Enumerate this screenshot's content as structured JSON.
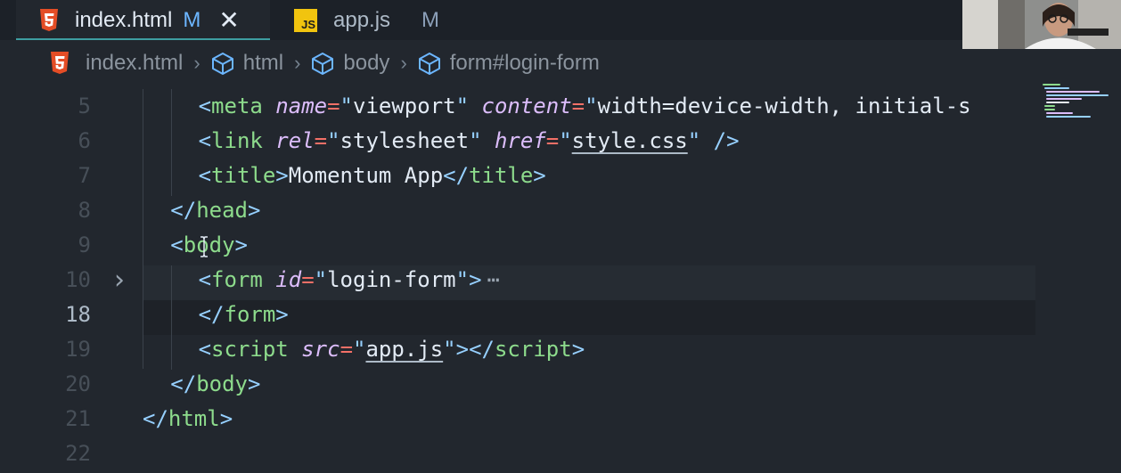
{
  "tabs": [
    {
      "label": "index.html",
      "status": "M",
      "icon": "html5-icon",
      "active": true
    },
    {
      "label": "app.js",
      "status": "M",
      "icon": "js-icon",
      "icon_text": "JS",
      "active": false
    }
  ],
  "breadcrumb": [
    {
      "label": "index.html",
      "icon": "html5-icon"
    },
    {
      "label": "html",
      "icon": "cube-icon"
    },
    {
      "label": "body",
      "icon": "cube-icon"
    },
    {
      "label": "form#login-form",
      "icon": "cube-icon"
    }
  ],
  "editor": {
    "lines": [
      {
        "num": "5",
        "tokens": [
          {
            "t": "punct",
            "v": "<"
          },
          {
            "t": "tag",
            "v": "meta"
          },
          {
            "t": "text",
            "v": " "
          },
          {
            "t": "attr",
            "v": "name"
          },
          {
            "t": "eq",
            "v": "="
          },
          {
            "t": "str",
            "v": "\""
          },
          {
            "t": "str-text",
            "v": "viewport"
          },
          {
            "t": "str",
            "v": "\""
          },
          {
            "t": "text",
            "v": " "
          },
          {
            "t": "attr",
            "v": "content"
          },
          {
            "t": "eq",
            "v": "="
          },
          {
            "t": "str",
            "v": "\""
          },
          {
            "t": "str-text",
            "v": "width=device-width, initial-s"
          }
        ]
      },
      {
        "num": "6",
        "tokens": [
          {
            "t": "punct",
            "v": "<"
          },
          {
            "t": "tag",
            "v": "link"
          },
          {
            "t": "text",
            "v": " "
          },
          {
            "t": "attr",
            "v": "rel"
          },
          {
            "t": "eq",
            "v": "="
          },
          {
            "t": "str",
            "v": "\""
          },
          {
            "t": "str-text",
            "v": "stylesheet"
          },
          {
            "t": "str",
            "v": "\""
          },
          {
            "t": "text",
            "v": " "
          },
          {
            "t": "attr",
            "v": "href"
          },
          {
            "t": "eq",
            "v": "="
          },
          {
            "t": "str",
            "v": "\""
          },
          {
            "t": "link",
            "v": "style.css"
          },
          {
            "t": "str",
            "v": "\""
          },
          {
            "t": "text",
            "v": " "
          },
          {
            "t": "punct",
            "v": "/>"
          }
        ]
      },
      {
        "num": "7",
        "tokens": [
          {
            "t": "punct",
            "v": "<"
          },
          {
            "t": "tag",
            "v": "title"
          },
          {
            "t": "punct",
            "v": ">"
          },
          {
            "t": "text",
            "v": "Momentum App"
          },
          {
            "t": "punct",
            "v": "</"
          },
          {
            "t": "tag",
            "v": "title"
          },
          {
            "t": "punct",
            "v": ">"
          }
        ]
      },
      {
        "num": "8",
        "tokens": [
          {
            "t": "punct",
            "v": "</"
          },
          {
            "t": "tag",
            "v": "head"
          },
          {
            "t": "punct",
            "v": ">"
          }
        ]
      },
      {
        "num": "9",
        "tokens": [
          {
            "t": "punct",
            "v": "<"
          },
          {
            "t": "tag",
            "v": "body"
          },
          {
            "t": "punct",
            "v": ">"
          }
        ]
      },
      {
        "num": "10",
        "folded": true,
        "tokens": [
          {
            "t": "punct",
            "v": "<"
          },
          {
            "t": "tag",
            "v": "form"
          },
          {
            "t": "text",
            "v": " "
          },
          {
            "t": "attr",
            "v": "id"
          },
          {
            "t": "eq",
            "v": "="
          },
          {
            "t": "str",
            "v": "\""
          },
          {
            "t": "str-text",
            "v": "login-form"
          },
          {
            "t": "str",
            "v": "\""
          },
          {
            "t": "punct",
            "v": ">"
          }
        ]
      },
      {
        "num": "18",
        "current": true,
        "tokens": [
          {
            "t": "punct",
            "v": "</"
          },
          {
            "t": "tag",
            "v": "form"
          },
          {
            "t": "punct",
            "v": ">"
          }
        ]
      },
      {
        "num": "19",
        "tokens": [
          {
            "t": "punct",
            "v": "<"
          },
          {
            "t": "tag",
            "v": "script"
          },
          {
            "t": "text",
            "v": " "
          },
          {
            "t": "attr",
            "v": "src"
          },
          {
            "t": "eq",
            "v": "="
          },
          {
            "t": "str",
            "v": "\""
          },
          {
            "t": "link",
            "v": "app.js"
          },
          {
            "t": "str",
            "v": "\""
          },
          {
            "t": "punct",
            "v": ">"
          },
          {
            "t": "punct",
            "v": "</"
          },
          {
            "t": "tag",
            "v": "script"
          },
          {
            "t": "punct",
            "v": ">"
          }
        ]
      },
      {
        "num": "20",
        "tokens": [
          {
            "t": "punct",
            "v": "</"
          },
          {
            "t": "tag",
            "v": "body"
          },
          {
            "t": "punct",
            "v": ">"
          }
        ]
      },
      {
        "num": "21",
        "tokens": [
          {
            "t": "punct",
            "v": "</"
          },
          {
            "t": "tag",
            "v": "html"
          },
          {
            "t": "punct",
            "v": ">"
          }
        ]
      },
      {
        "num": "22",
        "tokens": []
      }
    ],
    "fold_ellipsis": "⋯"
  },
  "colors": {
    "background": "#22272e",
    "tag": "#8ddb8c",
    "attribute": "#dcbdfb",
    "string": "#96d0ff",
    "accent": "#3e9ea1"
  }
}
